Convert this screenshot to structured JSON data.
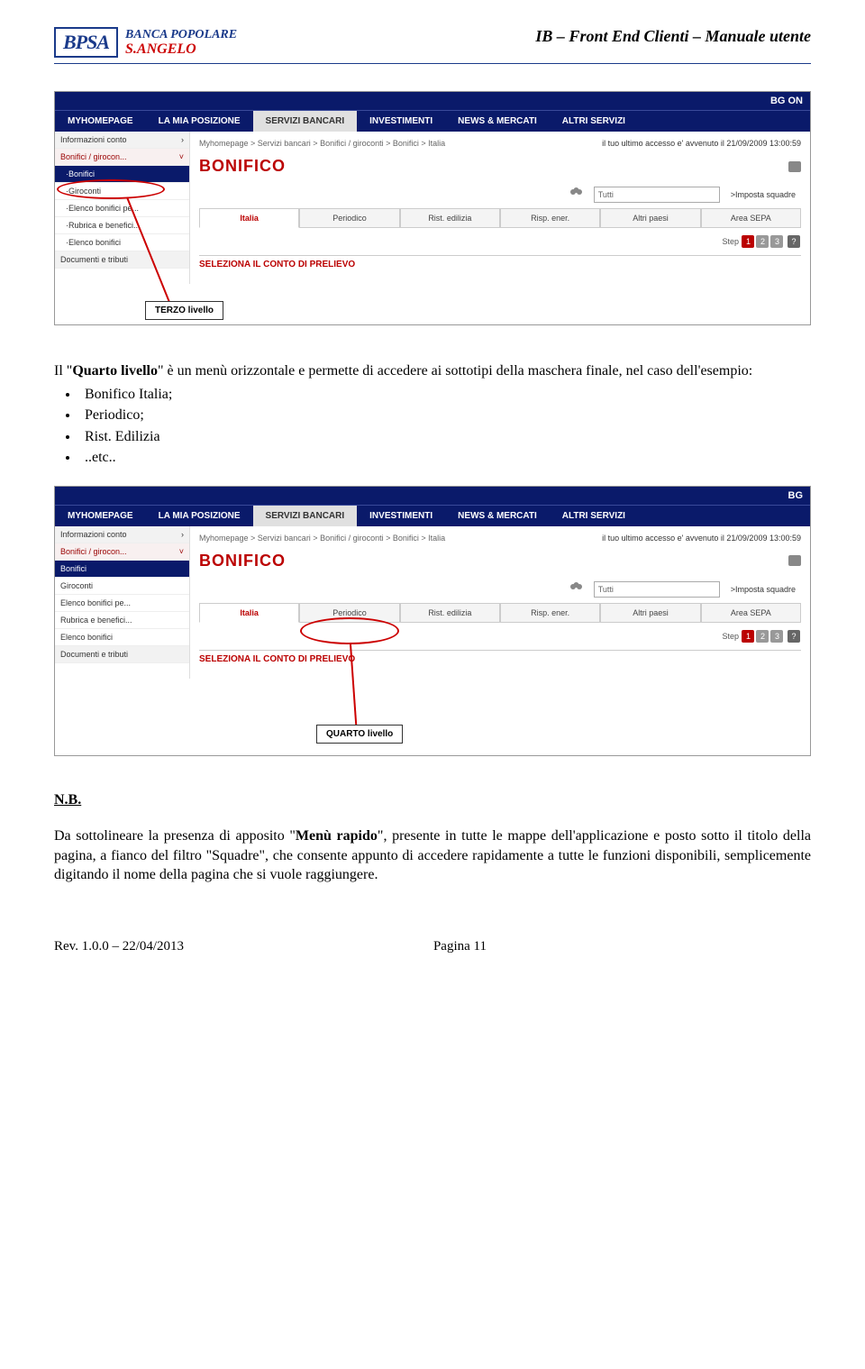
{
  "header": {
    "logo_badge": "BPSA",
    "logo_line1": "BANCA POPOLARE",
    "logo_line2": "S.ANGELO",
    "title": "IB – Front End Clienti – Manuale utente"
  },
  "screenshot1": {
    "top_label": "BG ON",
    "menu": [
      "MYHOMEPAGE",
      "LA MIA POSIZIONE",
      "SERVIZI BANCARI",
      "INVESTIMENTI",
      "NEWS & MERCATI",
      "ALTRI SERVIZI"
    ],
    "breadcrumb": "Myhomepage > Servizi bancari > Bonifici / giroconti > Bonifici > Italia",
    "access_text": "il tuo ultimo accesso e' avvenuto il 21/09/2009 13:00:59",
    "page_title": "BONIFICO",
    "sidebar": {
      "info": "Informazioni conto",
      "cat": "Bonifici / girocon...",
      "items": [
        "·Bonifici",
        "·Giroconti",
        "·Elenco bonifici pe...",
        "·Rubrica e benefici...",
        "·Elenco bonifici"
      ],
      "last": "Documenti e tributi"
    },
    "quick_input": "Tutti",
    "quick_btn": ">Imposta squadre",
    "tabs": [
      "Italia",
      "Periodico",
      "Rist. edilizia",
      "Risp. ener.",
      "Altri paesi",
      "Area SEPA"
    ],
    "step_label": "Step",
    "selection": "SELEZIONA IL CONTO DI PRELIEVO",
    "annot": "TERZO livello"
  },
  "paragraph1": {
    "p1_before_bold": "Il \"",
    "p1_bold": "Quarto livello",
    "p1_after_bold": "\" è un menù orizzontale e permette di accedere ai sottotipi della maschera finale, nel caso dell'esempio:",
    "items": [
      "Bonifico Italia;",
      "Periodico;",
      "Rist. Edilizia",
      "..etc.."
    ]
  },
  "screenshot2": {
    "top_label": "BG",
    "menu": [
      "MYHOMEPAGE",
      "LA MIA POSIZIONE",
      "SERVIZI BANCARI",
      "INVESTIMENTI",
      "NEWS & MERCATI",
      "ALTRI SERVIZI"
    ],
    "breadcrumb": "Myhomepage > Servizi bancari > Bonifici / giroconti > Bonifici > Italia",
    "access_text": "il tuo ultimo accesso e' avvenuto il 21/09/2009 13:00:59",
    "page_title": "BONIFICO",
    "sidebar": {
      "info": "Informazioni conto",
      "cat": "Bonifici / girocon...",
      "items": [
        "Bonifici",
        "Giroconti",
        "Elenco bonifici pe...",
        "Rubrica e benefici...",
        "Elenco bonifici"
      ],
      "last": "Documenti e tributi"
    },
    "quick_input": "Tutti",
    "quick_btn": ">Imposta squadre",
    "tabs": [
      "Italia",
      "Periodico",
      "Rist. edilizia",
      "Risp. ener.",
      "Altri paesi",
      "Area SEPA"
    ],
    "step_label": "Step",
    "selection": "SELEZIONA IL CONTO DI PRELIEVO",
    "annot": "QUARTO livello"
  },
  "nb": {
    "label": "N.B.",
    "text_before": "Da sottolineare la presenza di apposito \"",
    "text_bold": "Menù rapido",
    "text_after": "\", presente in tutte le mappe dell'applicazione e posto sotto il titolo della pagina, a fianco del filtro \"Squadre\", che consente appunto di accedere rapidamente a tutte le funzioni disponibili, semplicemente digitando il nome della pagina che si vuole raggiungere."
  },
  "footer": {
    "left": "Rev. 1.0.0 – 22/04/2013",
    "right": "Pagina 11"
  }
}
